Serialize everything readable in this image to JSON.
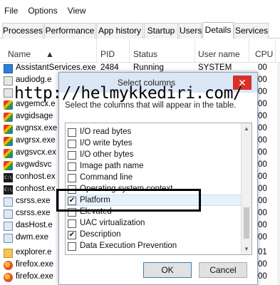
{
  "menu": {
    "file": "File",
    "options": "Options",
    "view": "View"
  },
  "tabs": [
    "Processes",
    "Performance",
    "App history",
    "Startup",
    "Users",
    "Details",
    "Services"
  ],
  "columns": {
    "name": "Name",
    "pid": "PID",
    "status": "Status",
    "user": "User name",
    "cpu": "CPU"
  },
  "processes": [
    {
      "name": "AssistantServices.exe",
      "pid": "2484",
      "status": "Running",
      "user": "SYSTEM",
      "cpu": "00",
      "icon": "blue-window-icon"
    },
    {
      "name": "audiodg.e",
      "pid": "",
      "status": "",
      "user": "",
      "cpu": "00",
      "icon": "generic-app-icon"
    },
    {
      "name": "",
      "pid": "",
      "status": "",
      "user": "",
      "cpu": "00",
      "icon": "generic-app-icon"
    },
    {
      "name": "avgemcx.e",
      "pid": "",
      "status": "",
      "user": "",
      "cpu": "00",
      "icon": "avg-icon"
    },
    {
      "name": "avgidsage",
      "pid": "",
      "status": "",
      "user": "",
      "cpu": "00",
      "icon": "avg-icon"
    },
    {
      "name": "avgnsx.exe",
      "pid": "",
      "status": "",
      "user": "",
      "cpu": "00",
      "icon": "avg-icon"
    },
    {
      "name": "avgrsx.exe",
      "pid": "",
      "status": "",
      "user": "",
      "cpu": "00",
      "icon": "avg-icon"
    },
    {
      "name": "avgsvcx.ex",
      "pid": "",
      "status": "",
      "user": "",
      "cpu": "00",
      "icon": "avg-icon"
    },
    {
      "name": "avgwdsvc",
      "pid": "",
      "status": "",
      "user": "",
      "cpu": "00",
      "icon": "avg-icon"
    },
    {
      "name": "conhost.ex",
      "pid": "",
      "status": "",
      "user": "",
      "cpu": "00",
      "icon": "console-icon"
    },
    {
      "name": "conhost.ex",
      "pid": "",
      "status": "",
      "user": "",
      "cpu": "00",
      "icon": "console-icon"
    },
    {
      "name": "csrss.exe",
      "pid": "",
      "status": "",
      "user": "",
      "cpu": "00",
      "icon": "generic-app-icon"
    },
    {
      "name": "csrss.exe",
      "pid": "",
      "status": "",
      "user": "",
      "cpu": "00",
      "icon": "generic-app-icon"
    },
    {
      "name": "dasHost.e",
      "pid": "",
      "status": "",
      "user": "",
      "cpu": "00",
      "icon": "generic-app-icon"
    },
    {
      "name": "dwm.exe",
      "pid": "",
      "status": "",
      "user": "",
      "cpu": "00",
      "icon": "generic-app-icon"
    },
    {
      "name": "explorer.e",
      "pid": "",
      "status": "",
      "user": "",
      "cpu": "01",
      "icon": "folder-icon"
    },
    {
      "name": "firefox.exe",
      "pid": "",
      "status": "",
      "user": "",
      "cpu": "00",
      "icon": "firefox-icon"
    },
    {
      "name": "firefox.exe",
      "pid": "",
      "status": "",
      "user": "",
      "cpu": "00",
      "icon": "firefox-icon"
    }
  ],
  "dialog": {
    "title": "Select columns",
    "close": "✕",
    "description": "Select the columns that will appear in the table.",
    "items": [
      {
        "label": "I/O read bytes",
        "checked": false
      },
      {
        "label": "I/O write bytes",
        "checked": false
      },
      {
        "label": "I/O other bytes",
        "checked": false
      },
      {
        "label": "Image path name",
        "checked": false
      },
      {
        "label": "Command line",
        "checked": false
      },
      {
        "label": "Operating system context",
        "checked": false
      },
      {
        "label": "Platform",
        "checked": true
      },
      {
        "label": "Elevated",
        "checked": false
      },
      {
        "label": "UAC virtualization",
        "checked": false
      },
      {
        "label": "Description",
        "checked": true
      },
      {
        "label": "Data Execution Prevention",
        "checked": false
      }
    ],
    "ok": "OK",
    "cancel": "Cancel"
  },
  "watermark": "http://helmykkediri.com/"
}
